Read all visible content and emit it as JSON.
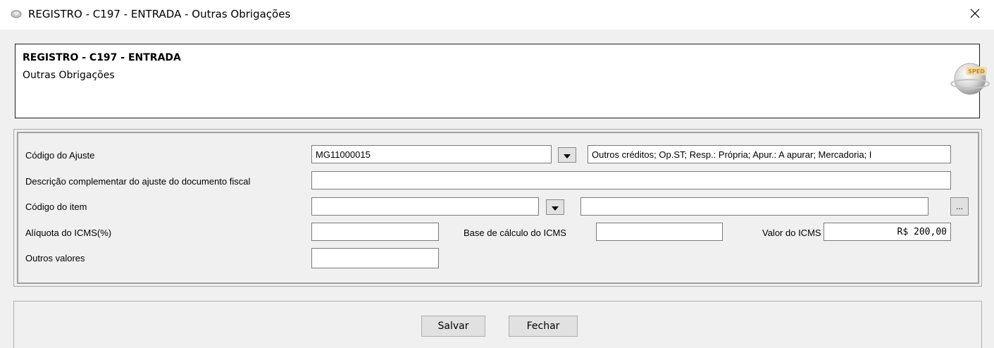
{
  "window": {
    "title": "REGISTRO - C197 - ENTRADA - Outras Obrigações",
    "close_glyph": "✕"
  },
  "header": {
    "title": "REGISTRO - C197 - ENTRADA",
    "subtitle": "Outras Obrigações",
    "logo_text": "SPED"
  },
  "form": {
    "codigo_ajuste": {
      "label": "Código do Ajuste",
      "value": "MG11000015",
      "description": "Outros créditos; Op.ST; Resp.: Própria; Apur.: A apurar; Mercadoria; I"
    },
    "descricao_complementar": {
      "label": "Descrição complementar do ajuste do documento fiscal",
      "value": ""
    },
    "codigo_item": {
      "label": "Código do item",
      "value": "",
      "description": "",
      "browse_label": "..."
    },
    "aliquota_icms": {
      "label": "Alíquota do ICMS(%)",
      "value": ""
    },
    "base_calculo_icms": {
      "label": "Base de cálculo do ICMS",
      "value": ""
    },
    "valor_icms": {
      "label": "Valor do ICMS",
      "value": "R$ 200,00"
    },
    "outros_valores": {
      "label": "Outros valores",
      "value": ""
    }
  },
  "buttons": {
    "save": "Salvar",
    "close": "Fechar"
  }
}
